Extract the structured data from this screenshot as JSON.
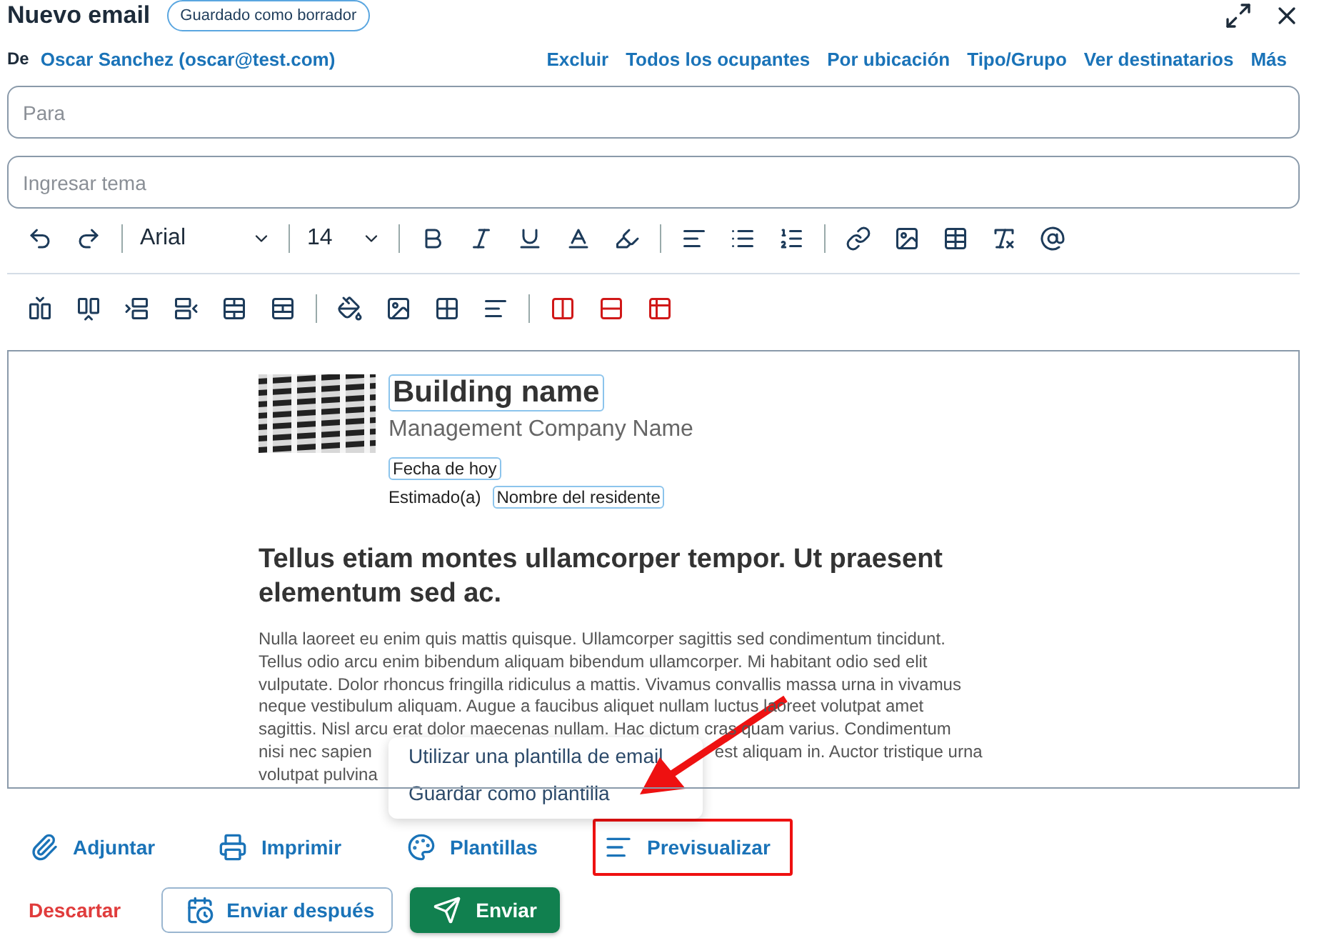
{
  "header": {
    "title": "Nuevo email",
    "badge": "Guardado como borrador"
  },
  "from": {
    "label": "De",
    "sender": "Oscar Sanchez (oscar@test.com)",
    "links": [
      "Excluir",
      "Todos los ocupantes",
      "Por ubicación",
      "Tipo/Grupo",
      "Ver destinatarios",
      "Más"
    ]
  },
  "to": {
    "placeholder": "Para"
  },
  "subject": {
    "placeholder": "Ingresar tema"
  },
  "toolbar": {
    "font": "Arial",
    "size": "14"
  },
  "letter": {
    "building": "Building name",
    "company": "Management Company Name",
    "date": "Fecha de hoy",
    "salutation": "Estimado(a)",
    "resident": "Nombre del residente",
    "heading": "Tellus etiam montes ullamcorper tempor. Ut praesent elementum sed ac.",
    "lines": [
      [
        "Nulla laoreet eu enim quis mattis quisque. Ullamcorper sagittis sed condimentum tincidunt."
      ],
      [
        "Tellus odio arcu enim bibendum aliquam bibendum ullamcorper. Mi habitant odio sed elit"
      ],
      [
        "vulputate. Dolor rhoncus fringilla ridiculus a mattis. Vivamus convallis massa urna in vivamus"
      ],
      [
        "neque vestibulum aliquam. Augue a faucibus aliquet nullam luctus laoreet volutpat amet"
      ],
      [
        "sagittis. Nisl arcu erat dolor maecenas nullam. Hac dictum cras quam varius. Condimentum"
      ],
      [
        "nisi nec sapien",
        "est aliquam in. Auctor tristique urna"
      ],
      [
        "volutpat pulvina"
      ]
    ]
  },
  "menu": {
    "items": [
      "Utilizar una plantilla de email",
      "Guardar como plantilla"
    ]
  },
  "actions": [
    {
      "kind": "attach",
      "label": "Adjuntar",
      "highlighted": false
    },
    {
      "kind": "print",
      "label": "Imprimir",
      "highlighted": false
    },
    {
      "kind": "templates",
      "label": "Plantillas",
      "highlighted": false
    },
    {
      "kind": "preview",
      "label": "Previsualizar",
      "highlighted": true
    }
  ],
  "footer": {
    "discard": "Descartar",
    "later": "Enviar después",
    "send": "Enviar"
  }
}
